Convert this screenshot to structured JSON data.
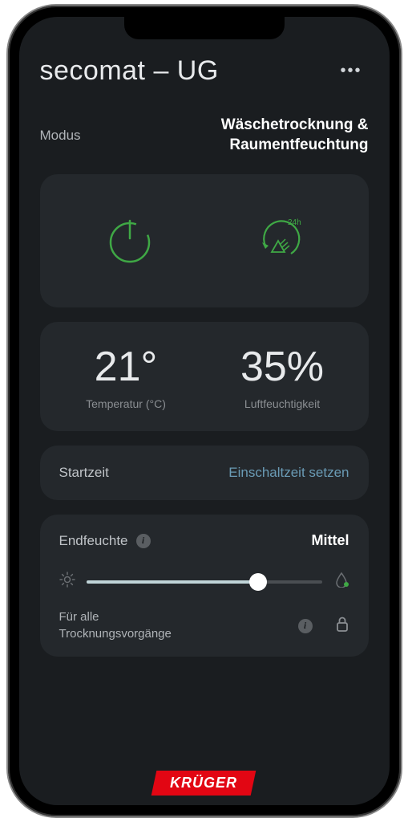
{
  "header": {
    "title": "secomat – UG"
  },
  "mode": {
    "label": "Modus",
    "value_line1": "Wäschetrocknung &",
    "value_line2": "Raumentfeuchtung"
  },
  "stats": {
    "temperature": {
      "value": "21°",
      "label": "Temperatur (°C)"
    },
    "humidity": {
      "value": "35%",
      "label": "Luftfeuchtigkeit"
    }
  },
  "start": {
    "label": "Startzeit",
    "action": "Einschaltzeit setzen"
  },
  "endHumidity": {
    "label": "Endfeuchte",
    "value": "Mittel",
    "footer_line1": "Für alle",
    "footer_line2": "Trocknungsvorgänge"
  },
  "brand": "KRÜGER",
  "colors": {
    "green": "#3fa845",
    "red": "#e20613"
  }
}
